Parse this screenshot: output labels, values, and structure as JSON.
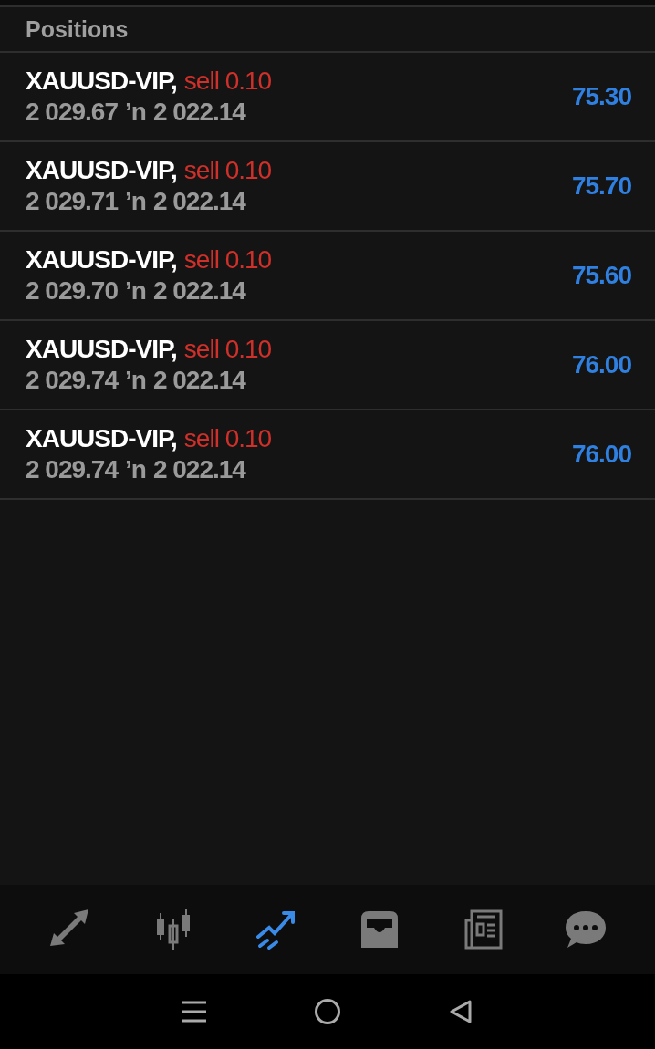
{
  "section_title": "Positions",
  "positions": [
    {
      "symbol": "XAUUSD-VIP,",
      "side": "sell 0.10",
      "open_price": "2 029.67",
      "arrow": "’n",
      "current_price": "2 022.14",
      "profit": "75.30"
    },
    {
      "symbol": "XAUUSD-VIP,",
      "side": "sell 0.10",
      "open_price": "2 029.71",
      "arrow": "’n",
      "current_price": "2 022.14",
      "profit": "75.70"
    },
    {
      "symbol": "XAUUSD-VIP,",
      "side": "sell 0.10",
      "open_price": "2 029.70",
      "arrow": "’n",
      "current_price": "2 022.14",
      "profit": "75.60"
    },
    {
      "symbol": "XAUUSD-VIP,",
      "side": "sell 0.10",
      "open_price": "2 029.74",
      "arrow": "’n",
      "current_price": "2 022.14",
      "profit": "76.00"
    },
    {
      "symbol": "XAUUSD-VIP,",
      "side": "sell 0.10",
      "open_price": "2 029.74",
      "arrow": "’n",
      "current_price": "2 022.14",
      "profit": "76.00"
    }
  ],
  "tabs": [
    {
      "kind": "quotes",
      "selected": false
    },
    {
      "kind": "chart",
      "selected": false
    },
    {
      "kind": "trade",
      "selected": true
    },
    {
      "kind": "history",
      "selected": false
    },
    {
      "kind": "news",
      "selected": false
    },
    {
      "kind": "messages",
      "selected": false
    }
  ]
}
